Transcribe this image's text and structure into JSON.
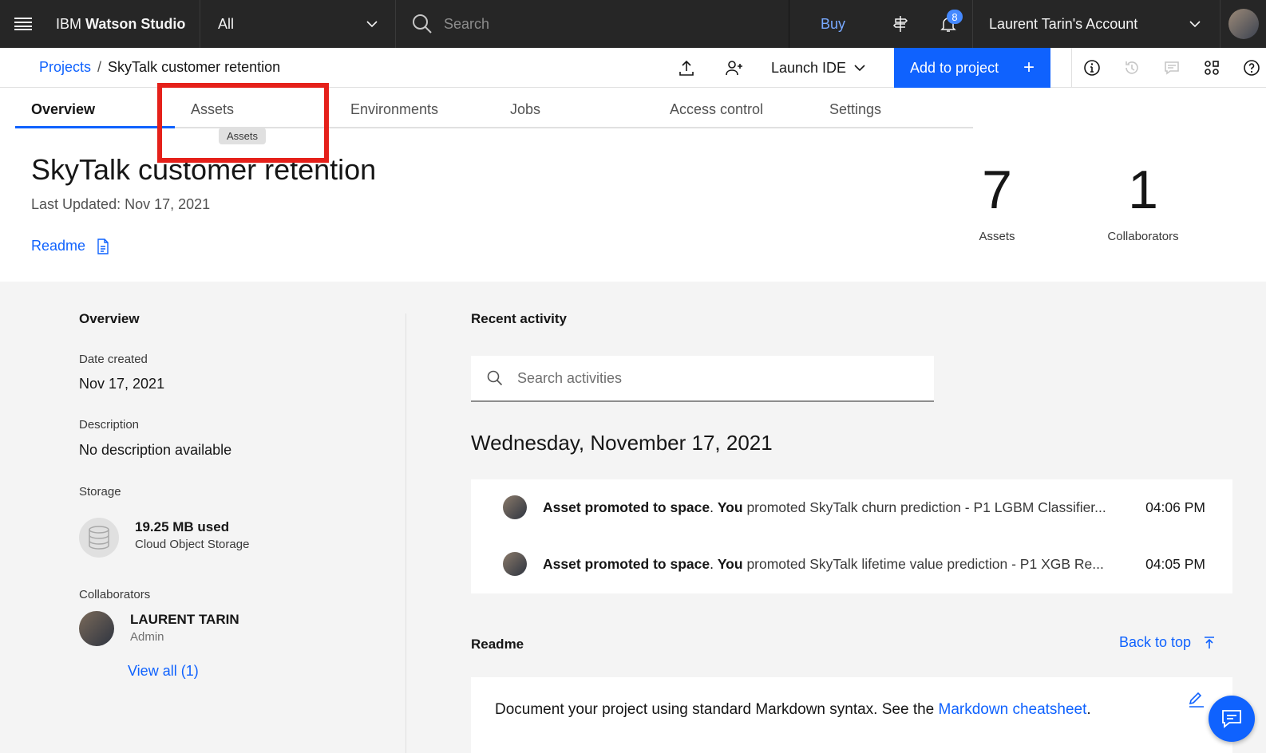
{
  "topbar": {
    "brand_prefix": "IBM ",
    "brand_name": "Watson Studio",
    "scope_value": "All",
    "search_placeholder": "Search",
    "buy_label": "Buy",
    "notification_count": "8",
    "account_label": "Laurent Tarin's Account"
  },
  "breadcrumb": {
    "parent": "Projects",
    "separator": "/",
    "current": "SkyTalk customer retention"
  },
  "toolbar": {
    "launch_ide_label": "Launch IDE",
    "add_to_project_label": "Add to project",
    "add_icon_text": "+"
  },
  "tabs": [
    {
      "label": "Overview",
      "active": true
    },
    {
      "label": "Assets",
      "active": false
    },
    {
      "label": "Environments",
      "active": false
    },
    {
      "label": "Jobs",
      "active": false
    },
    {
      "label": "Access control",
      "active": false
    },
    {
      "label": "Settings",
      "active": false
    }
  ],
  "tooltip": "Assets",
  "project": {
    "title": "SkyTalk customer retention",
    "last_updated": "Last Updated: Nov 17, 2021",
    "readme_link": "Readme"
  },
  "stats": [
    {
      "value": "7",
      "label": "Assets"
    },
    {
      "value": "1",
      "label": "Collaborators"
    }
  ],
  "overview": {
    "heading": "Overview",
    "date_created_label": "Date created",
    "date_created_value": "Nov 17, 2021",
    "description_label": "Description",
    "description_value": "No description available",
    "storage_label": "Storage",
    "storage_used": "19.25 MB used",
    "storage_type": "Cloud Object Storage",
    "collaborators_label": "Collaborators",
    "collaborator_name": "LAURENT TARIN",
    "collaborator_role": "Admin",
    "view_all": "View all (1)"
  },
  "activity": {
    "heading": "Recent activity",
    "search_placeholder": "Search activities",
    "date_heading": "Wednesday, November 17, 2021",
    "items": [
      {
        "event": "Asset promoted to space",
        "actor": "You",
        "detail": " promoted SkyTalk churn prediction - P1 LGBM Classifier...",
        "time": "04:06 PM"
      },
      {
        "event": "Asset promoted to space",
        "actor": "You",
        "detail": " promoted SkyTalk lifetime value prediction - P1 XGB Re...",
        "time": "04:05 PM"
      }
    ]
  },
  "readme": {
    "heading": "Readme",
    "back_to_top": "Back to top",
    "text_before": "Document your project using standard Markdown syntax. See the ",
    "link_text": "Markdown cheatsheet",
    "text_after": "."
  },
  "colors": {
    "accent": "#0f62fe",
    "topbar_bg": "#262626",
    "highlight": "#e5201a"
  }
}
